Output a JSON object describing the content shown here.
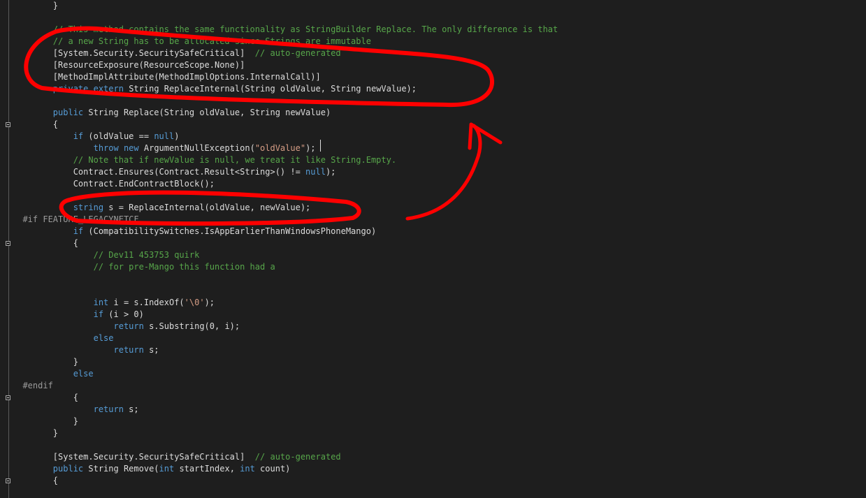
{
  "editor": {
    "lines": [
      {
        "indent": "        ",
        "parts": [
          {
            "t": "}",
            "c": "t"
          }
        ]
      },
      {
        "indent": "",
        "parts": []
      },
      {
        "indent": "        ",
        "parts": [
          {
            "t": "// This method contains the same functionality as StringBuilder Replace. The only difference is that",
            "c": "c"
          }
        ]
      },
      {
        "indent": "        ",
        "parts": [
          {
            "t": "// a new String has to be allocated since Strings are immutable",
            "c": "c"
          }
        ]
      },
      {
        "indent": "        ",
        "parts": [
          {
            "t": "[System.Security.SecuritySafeCritical]",
            "c": "t"
          },
          {
            "t": "  // auto-generated",
            "c": "c"
          }
        ]
      },
      {
        "indent": "        ",
        "parts": [
          {
            "t": "[ResourceExposure(ResourceScope.None)]",
            "c": "t"
          }
        ]
      },
      {
        "indent": "        ",
        "parts": [
          {
            "t": "[MethodImplAttribute(MethodImplOptions.InternalCall)]",
            "c": "t"
          }
        ]
      },
      {
        "indent": "        ",
        "parts": [
          {
            "t": "private",
            "c": "k"
          },
          {
            "t": " ",
            "c": "t"
          },
          {
            "t": "extern",
            "c": "k"
          },
          {
            "t": " String ReplaceInternal(String oldValue, String newValue);",
            "c": "t"
          }
        ]
      },
      {
        "indent": "",
        "parts": []
      },
      {
        "indent": "        ",
        "parts": [
          {
            "t": "public",
            "c": "k"
          },
          {
            "t": " String Replace(String oldValue, String newValue)",
            "c": "t"
          }
        ]
      },
      {
        "indent": "        ",
        "fold": true,
        "parts": [
          {
            "t": "{",
            "c": "t"
          }
        ]
      },
      {
        "indent": "            ",
        "parts": [
          {
            "t": "if",
            "c": "k"
          },
          {
            "t": " (oldValue == ",
            "c": "t"
          },
          {
            "t": "null",
            "c": "k"
          },
          {
            "t": ")",
            "c": "t"
          }
        ]
      },
      {
        "indent": "                ",
        "parts": [
          {
            "t": "throw",
            "c": "k"
          },
          {
            "t": " ",
            "c": "t"
          },
          {
            "t": "new",
            "c": "k"
          },
          {
            "t": " ArgumentNullException(",
            "c": "t"
          },
          {
            "t": "\"oldValue\"",
            "c": "s"
          },
          {
            "t": ");",
            "c": "t"
          }
        ]
      },
      {
        "indent": "            ",
        "parts": [
          {
            "t": "// Note that if newValue is null, we treat it like String.Empty.",
            "c": "c"
          }
        ]
      },
      {
        "indent": "            ",
        "parts": [
          {
            "t": "Contract.Ensures(Contract.Result<String>() != ",
            "c": "t"
          },
          {
            "t": "null",
            "c": "k"
          },
          {
            "t": ");",
            "c": "t"
          }
        ]
      },
      {
        "indent": "            ",
        "parts": [
          {
            "t": "Contract.EndContractBlock();",
            "c": "t"
          }
        ]
      },
      {
        "indent": "",
        "parts": []
      },
      {
        "indent": "            ",
        "parts": [
          {
            "t": "string",
            "c": "k"
          },
          {
            "t": " s = ReplaceInternal(oldValue, newValue);",
            "c": "t"
          }
        ]
      },
      {
        "indent": "  ",
        "parts": [
          {
            "t": "#if FEATURE_LEGACYNETCF",
            "c": "p"
          }
        ]
      },
      {
        "indent": "            ",
        "parts": [
          {
            "t": "if",
            "c": "k"
          },
          {
            "t": " (CompatibilitySwitches.IsAppEarlierThanWindowsPhoneMango)",
            "c": "t"
          }
        ]
      },
      {
        "indent": "            ",
        "fold": true,
        "parts": [
          {
            "t": "{",
            "c": "t"
          }
        ]
      },
      {
        "indent": "                ",
        "parts": [
          {
            "t": "// Dev11 453753 quirk",
            "c": "c"
          }
        ]
      },
      {
        "indent": "                ",
        "parts": [
          {
            "t": "// for pre-Mango this function had a",
            "c": "c"
          }
        ]
      },
      {
        "indent": "",
        "parts": []
      },
      {
        "indent": "",
        "parts": []
      },
      {
        "indent": "                ",
        "parts": [
          {
            "t": "int",
            "c": "k"
          },
          {
            "t": " i = s.IndexOf(",
            "c": "t"
          },
          {
            "t": "'\\0'",
            "c": "s"
          },
          {
            "t": ");",
            "c": "t"
          }
        ]
      },
      {
        "indent": "                ",
        "parts": [
          {
            "t": "if",
            "c": "k"
          },
          {
            "t": " (i > 0)",
            "c": "t"
          }
        ]
      },
      {
        "indent": "                    ",
        "parts": [
          {
            "t": "return",
            "c": "k"
          },
          {
            "t": " s.Substring(0, i);",
            "c": "t"
          }
        ]
      },
      {
        "indent": "                ",
        "parts": [
          {
            "t": "else",
            "c": "k"
          }
        ]
      },
      {
        "indent": "                    ",
        "parts": [
          {
            "t": "return",
            "c": "k"
          },
          {
            "t": " s;",
            "c": "t"
          }
        ]
      },
      {
        "indent": "            ",
        "parts": [
          {
            "t": "}",
            "c": "t"
          }
        ]
      },
      {
        "indent": "            ",
        "parts": [
          {
            "t": "else",
            "c": "k"
          }
        ]
      },
      {
        "indent": "  ",
        "parts": [
          {
            "t": "#endif",
            "c": "p"
          }
        ]
      },
      {
        "indent": "            ",
        "fold": true,
        "parts": [
          {
            "t": "{",
            "c": "t"
          }
        ]
      },
      {
        "indent": "                ",
        "parts": [
          {
            "t": "return",
            "c": "k"
          },
          {
            "t": " s;",
            "c": "t"
          }
        ]
      },
      {
        "indent": "            ",
        "parts": [
          {
            "t": "}",
            "c": "t"
          }
        ]
      },
      {
        "indent": "        ",
        "parts": [
          {
            "t": "}",
            "c": "t"
          }
        ]
      },
      {
        "indent": "",
        "parts": []
      },
      {
        "indent": "        ",
        "parts": [
          {
            "t": "[System.Security.SecuritySafeCritical]",
            "c": "t"
          },
          {
            "t": "  // auto-generated",
            "c": "c"
          }
        ]
      },
      {
        "indent": "        ",
        "parts": [
          {
            "t": "public",
            "c": "k"
          },
          {
            "t": " String Remove(",
            "c": "t"
          },
          {
            "t": "int",
            "c": "k"
          },
          {
            "t": " startIndex, ",
            "c": "t"
          },
          {
            "t": "int",
            "c": "k"
          },
          {
            "t": " count)",
            "c": "t"
          }
        ]
      },
      {
        "indent": "        ",
        "fold": true,
        "parts": [
          {
            "t": "{",
            "c": "t"
          }
        ]
      }
    ]
  },
  "annotation": {
    "color": "#ff0000"
  }
}
